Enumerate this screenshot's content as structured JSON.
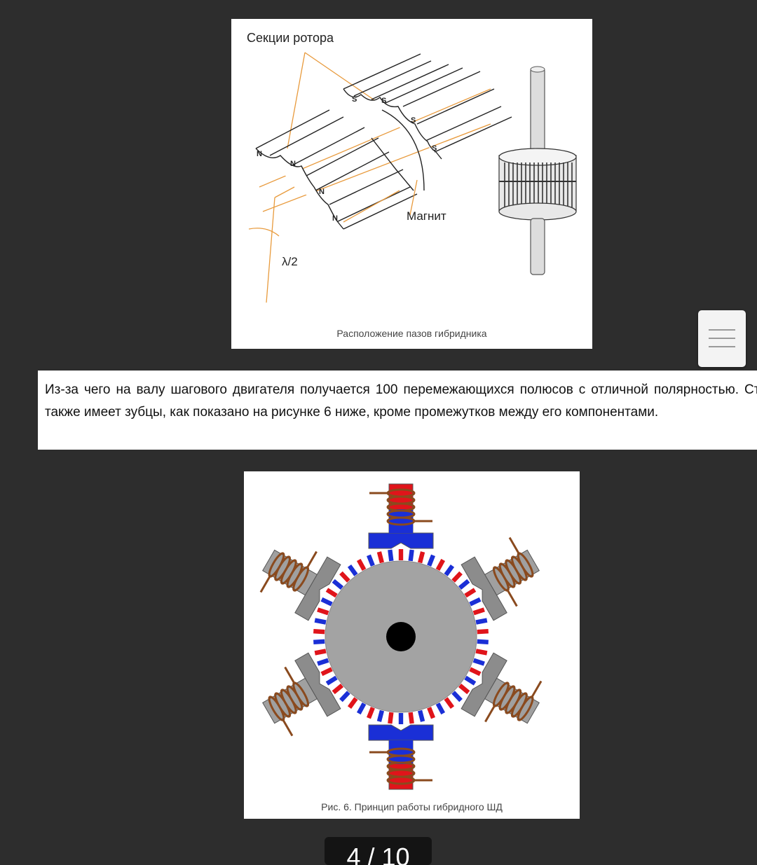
{
  "figure1": {
    "label_rotor_sections": "Секции ротора",
    "label_magnet": "Магнит",
    "label_lambda": "λ/2",
    "pole_n": "N",
    "pole_s": "S",
    "caption": "Расположение пазов гибридника"
  },
  "text": {
    "paragraph": "Из-за чего на валу шагового двигателя получается 100 перемежающихся полюсов с отличной полярностью. Статор также имеет зубцы, как показано на рисунке 6 ниже, кроме промежутков между его компонентами."
  },
  "figure2": {
    "caption": "Рис. 6. Принцип работы гибридного ШД"
  },
  "menu_button": {
    "icon": "hamburger-menu-icon"
  },
  "pager": {
    "text": "4 / 10"
  },
  "colors": {
    "background": "#2d2d2d",
    "accent_orange": "#e89a3c",
    "pole_red": "#e0141a",
    "pole_blue": "#1a2fd6",
    "coil_brown": "#8a4a1e"
  }
}
